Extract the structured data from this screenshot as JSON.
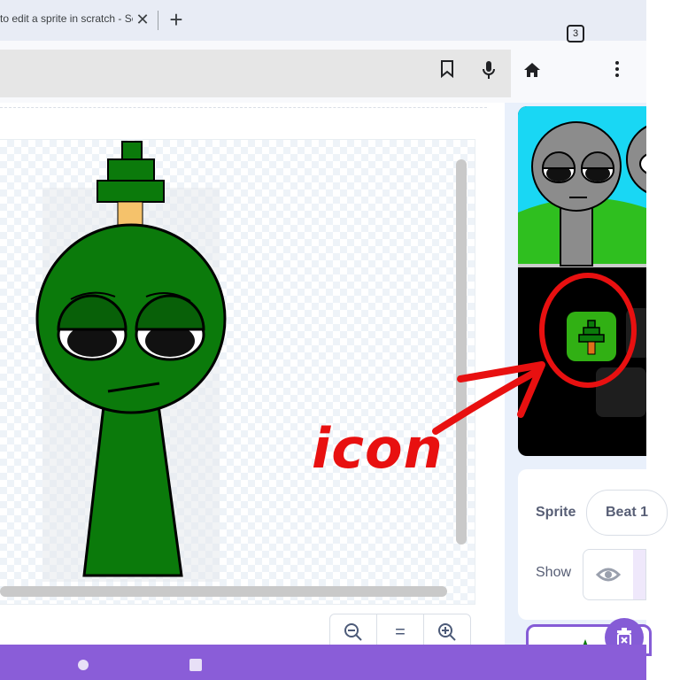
{
  "browser": {
    "tab_title": "to edit a sprite in scratch - Se",
    "tab_count": "3"
  },
  "editor": {
    "zoom_out": "−",
    "zoom_reset": "=",
    "zoom_in": "+"
  },
  "sprite_info": {
    "sprite_label": "Sprite",
    "sprite_name": "Beat 1",
    "show_label": "Show"
  },
  "annotation": {
    "text": "icon",
    "color": "#e81010"
  },
  "colors": {
    "accent": "#855cd6",
    "nav_bar": "#8a5dd8",
    "character_green": "#0b7a0b"
  }
}
